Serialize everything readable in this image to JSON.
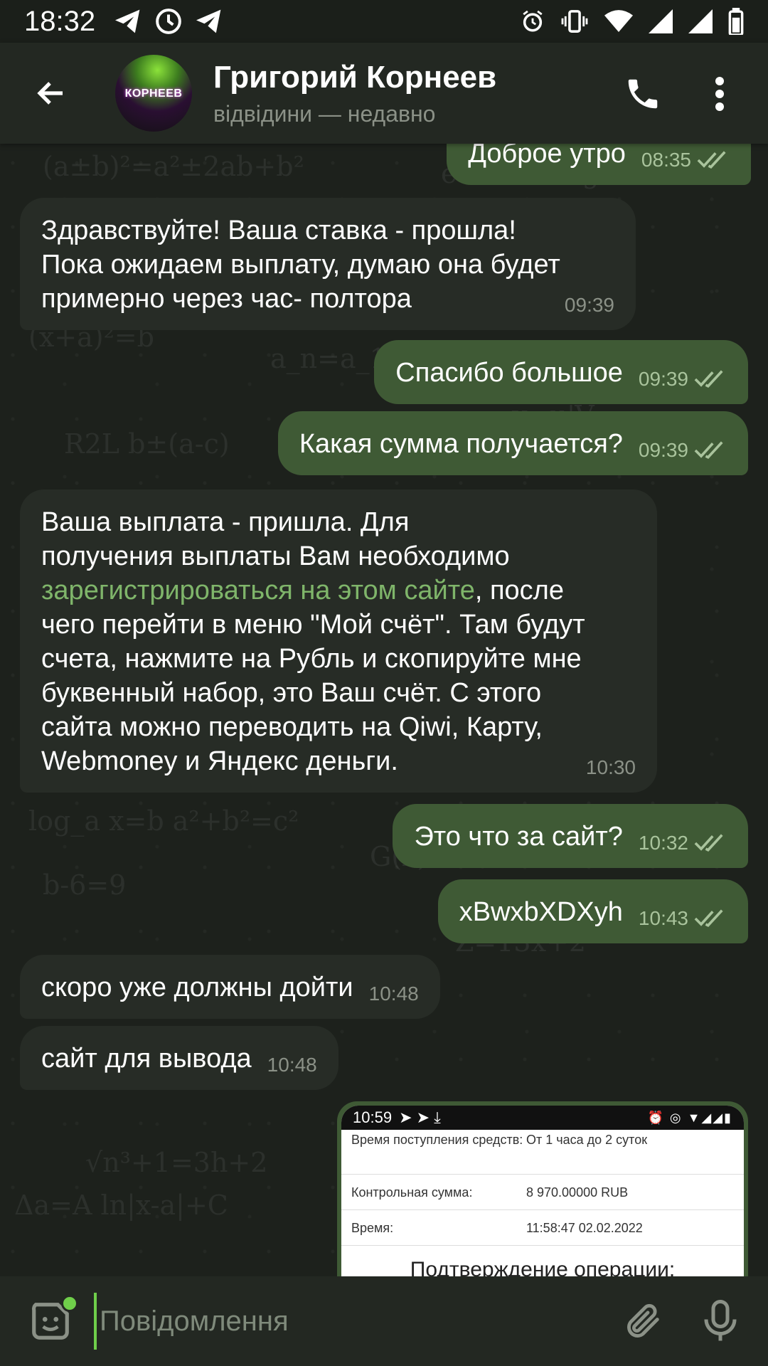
{
  "status_bar": {
    "time": "18:32",
    "icons": [
      "telegram-icon",
      "alarm-clock-app-icon",
      "telegram-icon",
      "alarm-icon",
      "vibrate-icon",
      "wifi-icon",
      "signal-icon",
      "signal-icon",
      "battery-icon"
    ]
  },
  "header": {
    "contact_name": "Григорий Корнеев",
    "contact_status": "відвідини — недавно",
    "avatar_text": "КОРНЕЕВ"
  },
  "messages": [
    {
      "dir": "out",
      "text": "Доброе утро",
      "time": "08:35",
      "read": true
    },
    {
      "dir": "in",
      "text": "Здравствуйте! Ваша ставка - прошла!\nПока ожидаем выплату, думаю она будет\nпримерно через час- полтора",
      "time": "09:39"
    },
    {
      "dir": "out",
      "text": "Спасибо большое",
      "time": "09:39",
      "read": true
    },
    {
      "dir": "out",
      "text": "Какая сумма получается?",
      "time": "09:39",
      "read": true
    },
    {
      "dir": "in",
      "text_before": "Ваша выплата - пришла. Для\nполучения выплаты Вам необходимо\n",
      "link": "зарегистрироваться на этом сайте",
      "text_after": ", после\nчего перейти в меню \"Мой счёт\". Там будут\nсчета, нажмите на Рубль и скопируйте мне\nбуквенный набор, это Ваш счёт. С этого\nсайта можно переводить на Qiwi, Карту,\nWebmoney и Яндекс деньги.",
      "time": "10:30"
    },
    {
      "dir": "out",
      "text": "Это что за сайт?",
      "time": "10:32",
      "read": true
    },
    {
      "dir": "out",
      "text": "xBwxbXDXyh",
      "time": "10:43",
      "read": true
    },
    {
      "dir": "in",
      "text": "скоро уже должны дойти",
      "time": "10:48"
    },
    {
      "dir": "in",
      "text": "сайт для вывода",
      "time": "10:48"
    }
  ],
  "screenshot_message": {
    "status_time": "10:59",
    "row1_label": "Время поступления средств:",
    "row1_value": "От 1 часа до 2 суток",
    "row2_label": "Контрольная сумма:",
    "row2_value": "8 970.00000 RUB",
    "row3_label": "Время:",
    "row3_value": "11:58:47 02.02.2022",
    "title": "Подтверждение операции:"
  },
  "input": {
    "placeholder": "Повідомлення"
  },
  "colors": {
    "outgoing_bubble": "#3f5a35",
    "incoming_bubble": "#272c26",
    "link": "#7fb56a",
    "accent": "#6fcf4a"
  }
}
